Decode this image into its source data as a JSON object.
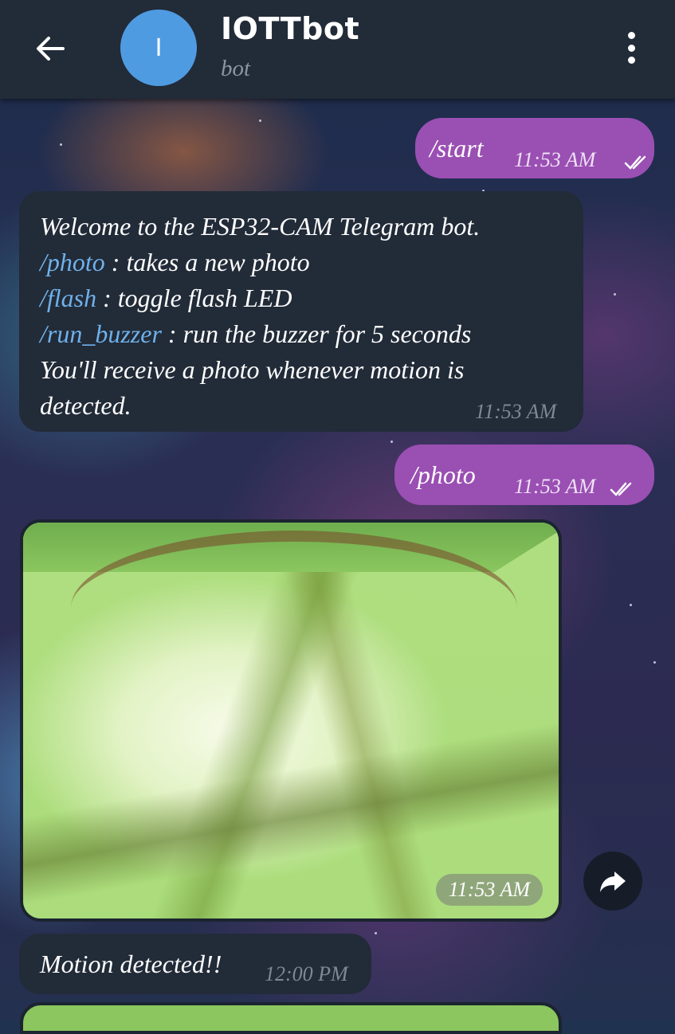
{
  "header": {
    "back_icon": "arrow-left-icon",
    "avatar_letter": "I",
    "avatar_color": "#4f9be2",
    "title": "IOTTbot",
    "subtitle": "bot",
    "menu_icon": "more-vertical-icon"
  },
  "messages": [
    {
      "type": "outgoing",
      "text": "/start",
      "time": "11:53 AM",
      "status": "read"
    },
    {
      "type": "incoming",
      "lines": [
        {
          "plain": "Welcome to the ESP32-CAM Telegram bot."
        },
        {
          "cmd": "/photo",
          "rest": " : takes a new photo"
        },
        {
          "cmd": "/flash",
          "rest": " : toggle flash LED"
        },
        {
          "cmd": "/run_buzzer",
          "rest": " : run the buzzer for 5 seconds"
        },
        {
          "plain": "You'll receive a photo whenever motion is"
        },
        {
          "plain": "detected."
        }
      ],
      "time": "11:53 AM"
    },
    {
      "type": "outgoing",
      "text": "/photo",
      "time": "11:53 AM",
      "status": "read"
    },
    {
      "type": "photo",
      "time": "11:53 AM",
      "action_icon": "share-icon"
    },
    {
      "type": "incoming",
      "text": "Motion detected!!",
      "time": "12:00 PM"
    }
  ],
  "colors": {
    "header_bg": "#222b38",
    "outgoing_bubble": "#9a4fb3",
    "incoming_bubble": "#222b38",
    "command_link": "#6fb1ea"
  }
}
